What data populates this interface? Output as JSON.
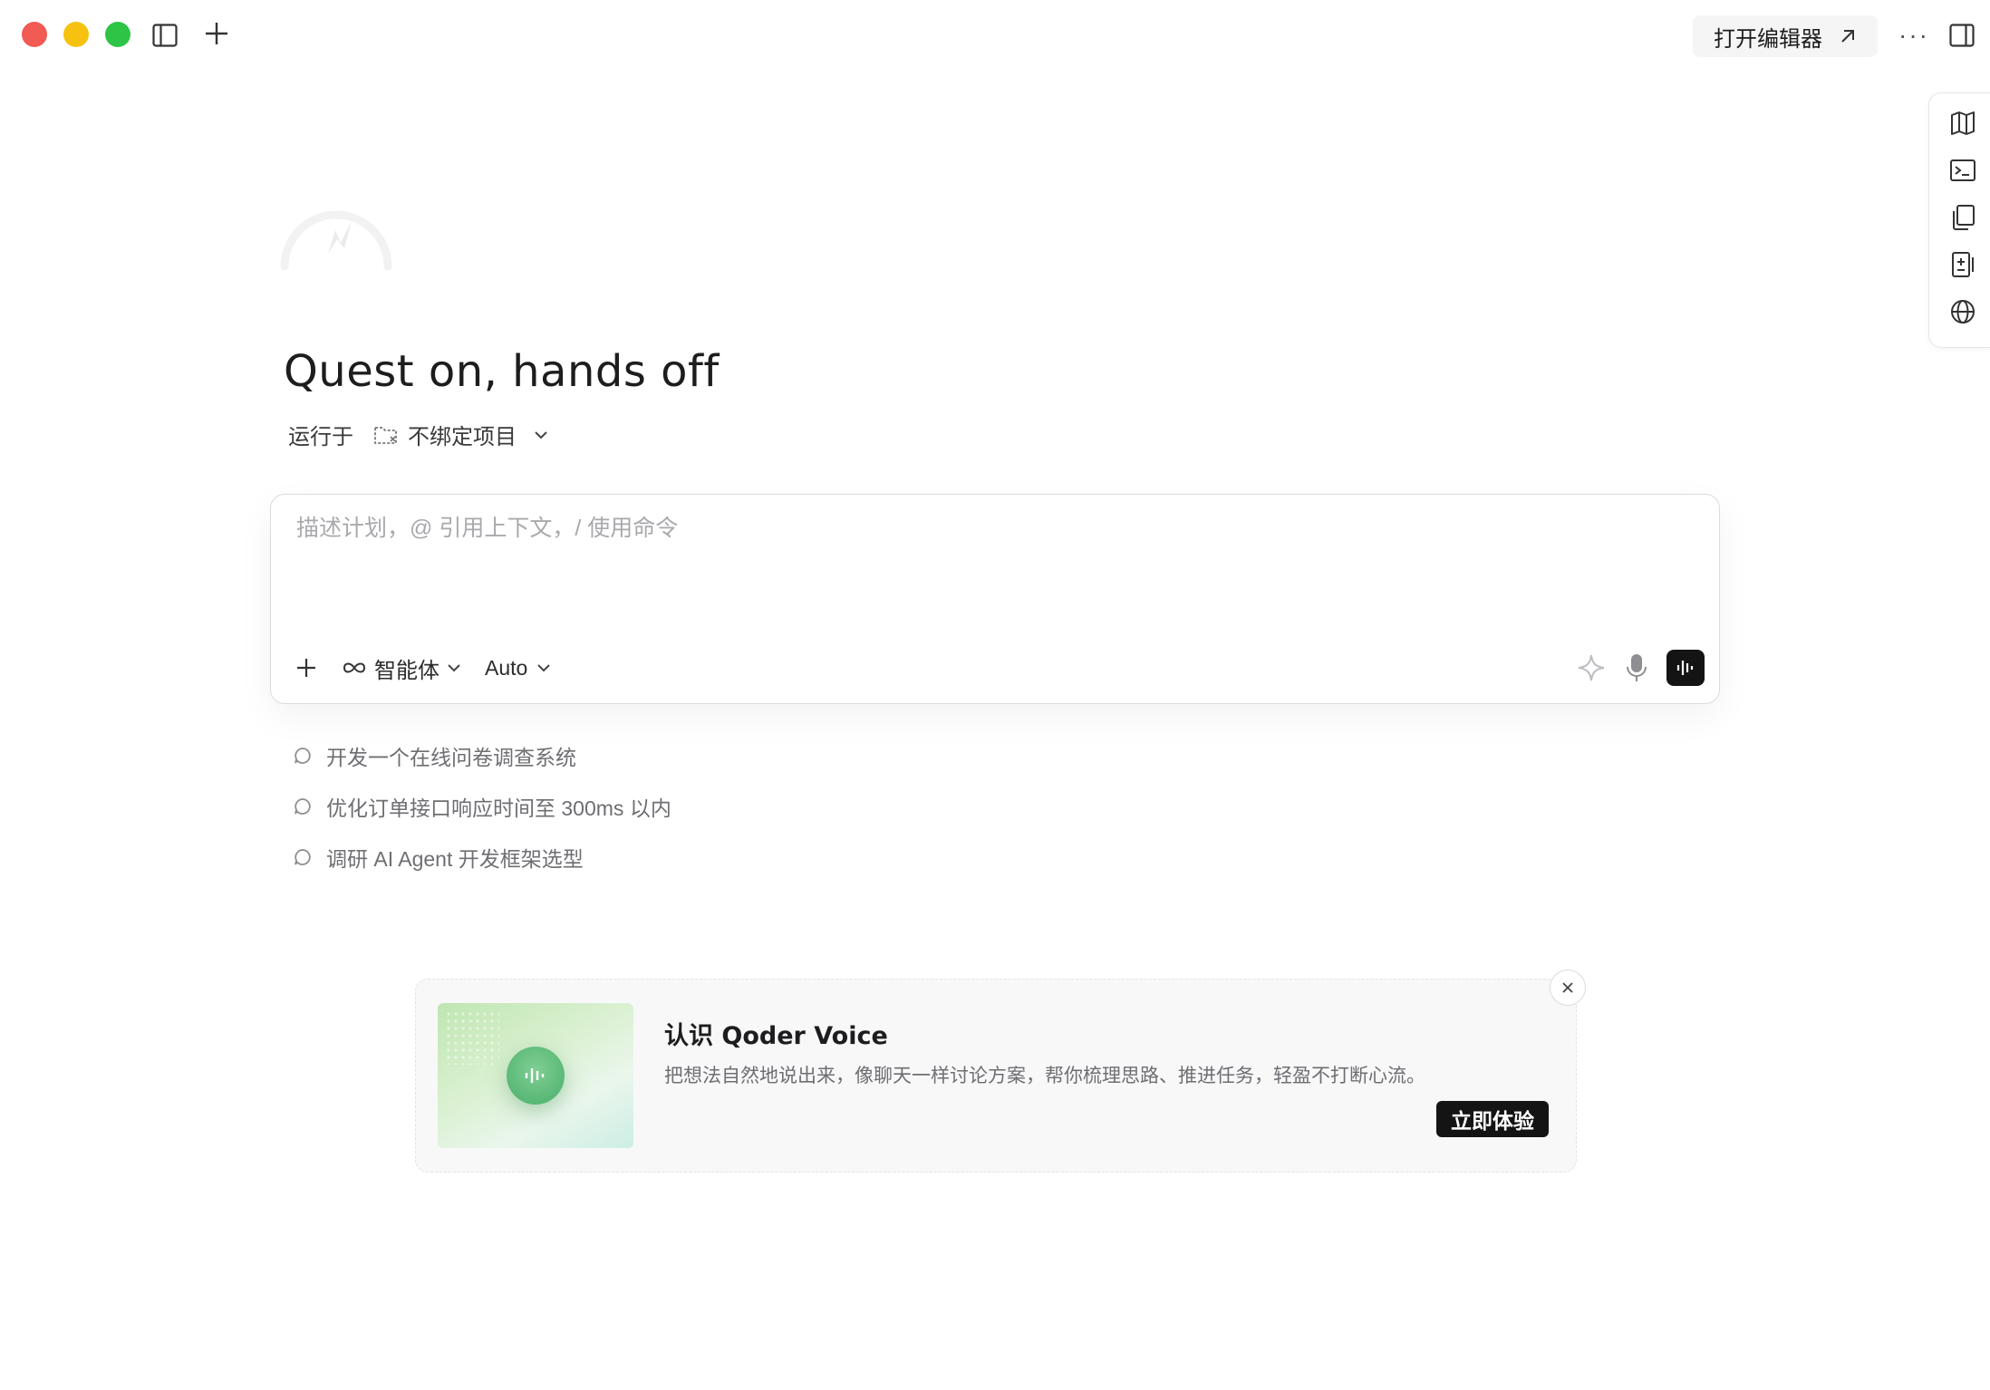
{
  "titlebar": {
    "open_editor_label": "打开编辑器",
    "more_label": "···"
  },
  "hero": {
    "title": "Quest on, hands off"
  },
  "run_target": {
    "prefix": "运行于",
    "project": "不绑定项目"
  },
  "composer": {
    "placeholder": "描述计划，@ 引用上下文，/ 使用命令",
    "value": "",
    "agent_label": "智能体",
    "model_label": "Auto"
  },
  "suggestions": [
    "开发一个在线问卷调查系统",
    "优化订单接口响应时间至 300ms 以内",
    "调研 AI Agent 开发框架选型"
  ],
  "promo": {
    "title": "认识 Qoder Voice",
    "description": "把想法自然地说出来，像聊天一样讨论方案，帮你梳理思路、推进任务，轻盈不打断心流。",
    "cta_label": "立即体验"
  },
  "icons": {
    "rail": [
      "map-icon",
      "terminal-icon",
      "copy-icon",
      "document-diff-icon",
      "globe-icon"
    ]
  },
  "colors": {
    "traffic_red": "#f25a54",
    "traffic_yellow": "#f6c10f",
    "traffic_green": "#2ec546",
    "primary_dark": "#141414",
    "muted_text": "#6e6e73",
    "placeholder": "#a9a9ad"
  }
}
